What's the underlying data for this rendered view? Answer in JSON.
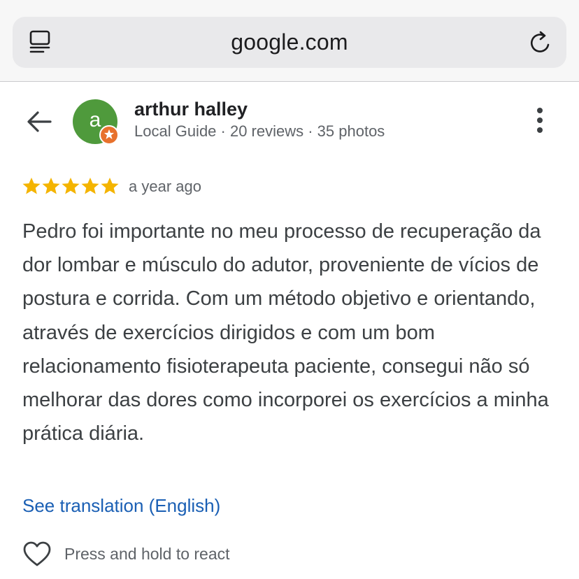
{
  "browser": {
    "url": "google.com",
    "tab_icon": "tabs-icon",
    "reload_icon": "reload-icon"
  },
  "reviewer": {
    "avatar_letter": "a",
    "name": "arthur halley",
    "meta": "Local Guide · 20 reviews · 35 photos",
    "avatar_color": "#4f9a3c",
    "badge_color": "#e8712c"
  },
  "review": {
    "rating": 5,
    "rating_max": 5,
    "star_color": "#f4b400",
    "date": "a year ago",
    "text": "Pedro foi importante no meu processo de recuperação da dor lombar e músculo do adutor, proveniente de vícios de postura e corrida. Com um método objetivo e orientando, através de exercícios dirigidos e com um bom relacionamento fisioterapeuta paciente, consegui não só melhorar das dores como incorporei os exercícios a minha prática diária.",
    "translate_link": "See translation (English)",
    "link_color": "#1a5fb4"
  },
  "react": {
    "label": "Press and hold to react",
    "icon": "heart-outline-icon"
  },
  "icons": {
    "back": "back-arrow-icon",
    "more": "more-vertical-icon"
  }
}
